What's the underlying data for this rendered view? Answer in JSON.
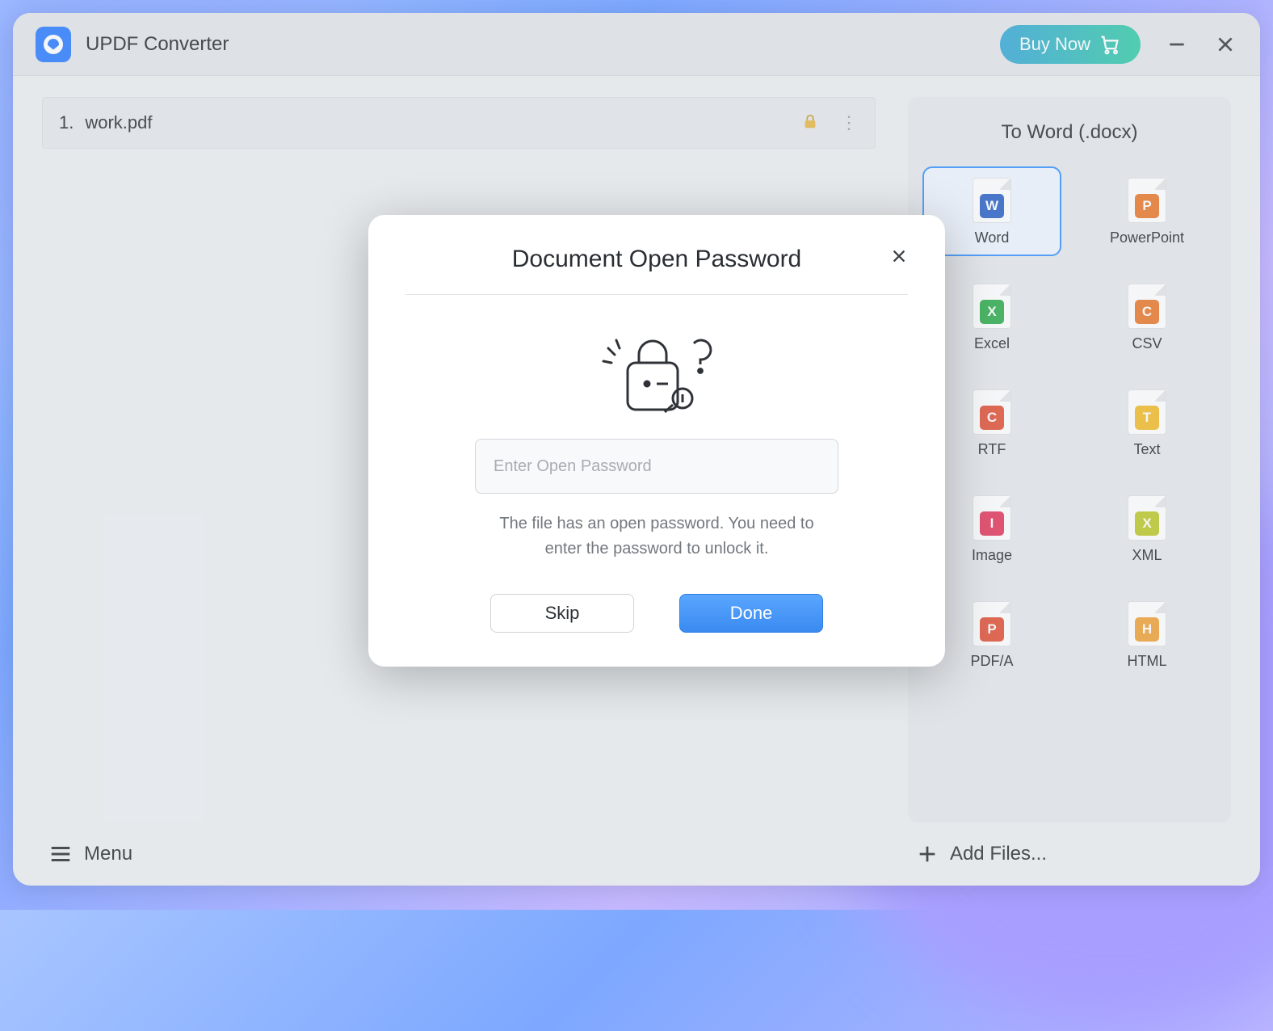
{
  "app": {
    "title": "UPDF Converter",
    "buy_now": "Buy Now"
  },
  "files": [
    {
      "index": "1.",
      "name": "work.pdf",
      "locked": true
    }
  ],
  "sidebar": {
    "title": "To Word (.docx)",
    "formats": [
      {
        "id": "word",
        "label": "Word",
        "letter": "W",
        "color": "#2f63c9",
        "selected": true
      },
      {
        "id": "powerpoint",
        "label": "PowerPoint",
        "letter": "P",
        "color": "#ea7b2e"
      },
      {
        "id": "excel",
        "label": "Excel",
        "letter": "X",
        "color": "#2fae4d"
      },
      {
        "id": "csv",
        "label": "CSV",
        "letter": "C",
        "color": "#ea7b2e"
      },
      {
        "id": "rtf",
        "label": "RTF",
        "letter": "C",
        "color": "#e2533a"
      },
      {
        "id": "text",
        "label": "Text",
        "letter": "T",
        "color": "#f2bd2d"
      },
      {
        "id": "image",
        "label": "Image",
        "letter": "I",
        "color": "#e43a5f"
      },
      {
        "id": "xml",
        "label": "XML",
        "letter": "X",
        "color": "#bdca2d"
      },
      {
        "id": "pdfa",
        "label": "PDF/A",
        "letter": "P",
        "color": "#e2533a"
      },
      {
        "id": "html",
        "label": "HTML",
        "letter": "H",
        "color": "#f1a33a"
      }
    ]
  },
  "footer": {
    "menu": "Menu",
    "add_files": "Add Files..."
  },
  "modal": {
    "title": "Document Open Password",
    "placeholder": "Enter Open Password",
    "help": "The file has an open password. You need to enter the password to unlock it.",
    "skip": "Skip",
    "done": "Done"
  }
}
